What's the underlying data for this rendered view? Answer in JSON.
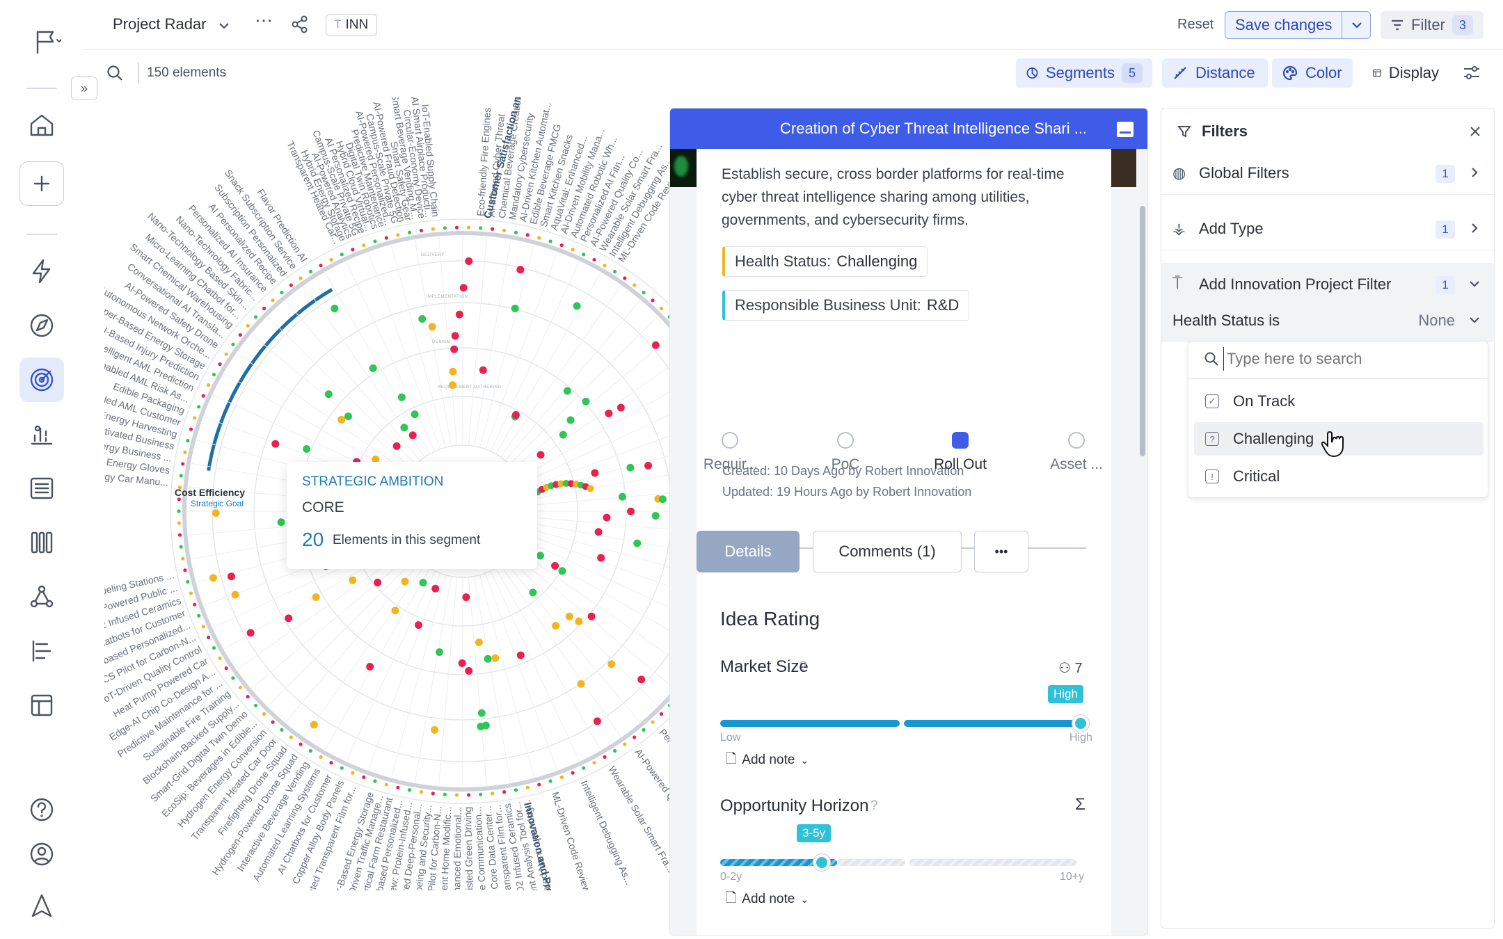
{
  "app": {
    "project_name": "Project Radar",
    "tag_label": "INN",
    "element_count": "150 elements"
  },
  "header": {
    "reset_label": "Reset",
    "save_label": "Save changes",
    "filter_label": "Filter",
    "filter_count": "3"
  },
  "toolbar": {
    "segments_label": "Segments",
    "segments_count": "5",
    "distance_label": "Distance",
    "color_label": "Color",
    "display_label": "Display"
  },
  "radar": {
    "tooltip_heading": "STRATEGIC AMBITION",
    "tooltip_segment": "CORE",
    "tooltip_count": "20",
    "tooltip_suffix": "Elements in this segment",
    "goal_label": "Cost Efficiency",
    "goal_sub": "Strategic Goal",
    "segment_top": "Customer Satisfaction and ...",
    "segment_bottom": "Innovation and Product De...",
    "ring_labels": [
      "DELIVERY",
      "IMPLEMENTATION",
      "DESIGN",
      "REQUIREMENT GATHERING"
    ],
    "left_labels": [
      "Hydrogen Energy Car Manu...",
      "Smart Energy Gloves",
      "Smart Energy Business ...",
      "Voice-Activated Business",
      "Hydrogen Energy Harvesting",
      "AI-Enabled AML Customer",
      "Edible Packaging",
      "AI-Enabled AML Risk As...",
      "Intelligent AML Prediction",
      "AI-Based Injury Prediction",
      "Copper-Based Energy Storage",
      "Autonomous Network Orche...",
      "AI-Powered Safety Drone",
      "Conversational AI Transla...",
      "Smart Chemical Warehousing",
      "Micro-Learning Chatbot for...",
      "Nano-Technology Based Skin...",
      "Nano-Technology Fabric...",
      "Personalized AI Insurance",
      "AI Personalized Recipe",
      "Subscription Personalized",
      "Snack Subscription Service",
      "Flavor Prediction AI",
      "Hydrogen Fueling Stations ...",
      "Hydrogen-Powered Public ...",
      "TiO2 Infused Ceramics",
      "AI Chatbots for Customer",
      "Cloud-based Personalized...",
      "BECCS Pilot for Carbon-N...",
      "IoT-Driven Quality Control",
      "Heat Pump Powered Car",
      "Edge-AI Chip Co-Design A...",
      "Predictive Maintenance for ...",
      "Sustainable Fire Training",
      "Blockchain-Backed Supply...",
      "Smart-Grid Digital Twin Demo",
      "EcoSip: Beverages in Edible...",
      "Hydrogen Energy Conversion",
      "Transparent Heated Car Door",
      "Firefighting Drone Squad",
      "Hydrogen-Powered Drone Squad",
      "Interactive Beverage Vending",
      "Automated Learning Systems",
      "AI Chatbots for Customer",
      "Copper Alloy Body Panels",
      "Heated Transparent Film for..."
    ],
    "top_labels": [
      "Transparent Heated Car...",
      "Hybrid Energy Storage",
      "AI-Powered Analytics",
      "Campus-Scale Private 5G",
      "AI Personalized Recipe",
      "Hybrid Cloud Virtual...",
      "Digital Twin Robotics",
      "Predictive Maintenance",
      "AI-Powered Personalized...",
      "Campus-Scale Private 5G",
      "AI-Powered Fraud Detection",
      "Smart Safety Gear",
      "Smart Beverage Vending M...",
      "Circular-Economy Device",
      "AI Smart Airplace Producti...",
      "IoT-Enabled Supply Chain"
    ],
    "right_labels": [
      "Eco-friendly Fire Engines",
      "AI-Infused Cyber Threat",
      "Chemical Beverage Creation",
      "Mandatory Cybersecurity",
      "AI-Driven Kitchen Automat...",
      "Edible Beverage FMCG",
      "Smart Kitchen Snacks",
      "AquaVital: Enhanced...",
      "AI-Driven Mobility Mana...",
      "Automated Robotic Wh...",
      "Personalized AI Fitn...",
      "AI-Powered Quality Co...",
      "Wearable Solar Smart Fra...",
      "Intelligent Debugging As...",
      "ML-Driven Code Review System"
    ],
    "bottom_labels": [
      "Copper-Based Energy Storage",
      "AI-Driven Traffic Manage...",
      "Vertical Farm Restaurant",
      "Cloud-based Personalized...",
      "Proteindrew: Protein-Infused...",
      "Federated Deep-Personal...",
      "Well-being and Security...",
      "BECCS Pilot for Carbon-N...",
      "Intelligent Home Modific...",
      "AI-Enhanced Emotional...",
      "AI-Assisted Green Driving",
      "Immersive Communication...",
      "Sustainable Core Data Center...",
      "AI-Heated Transparent Film for...",
      "TiO2 Infused Ceramics",
      "Sentiment Analysis Tool for...",
      "AI-Generated Nano-Learning..."
    ]
  },
  "detail": {
    "title": "Creation of Cyber Threat Intelligence Shari ...",
    "description_lines": [
      "Establish secure, cross border platforms for real-time",
      "cyber threat intelligence sharing among utilities,",
      "governments, and cybersecurity firms."
    ],
    "health_label": "Health Status:",
    "health_value": "Challenging",
    "bu_label": "Responsible Business Unit:",
    "bu_value": "R&D",
    "created": "Created: 10 Days Ago by Robert Innovation",
    "updated": "Updated: 19 Hours Ago by Robert Innovation",
    "steps": [
      "Requir...",
      "PoC",
      "Roll Out",
      "Asset ..."
    ],
    "active_step": 2,
    "tabs": {
      "details": "Details",
      "comments": "Comments (1)",
      "more": "•••"
    },
    "rating_title": "Idea Rating",
    "market_size": {
      "label": "Market Size",
      "voters": "7",
      "badge": "High",
      "low": "Low",
      "high": "High",
      "value": 1.0,
      "note": "Add note"
    },
    "horizon": {
      "label": "Opportunity Horizon",
      "badge": "3-5y",
      "low": "0-2y",
      "high": "10+y",
      "value": 0.33,
      "note": "Add note"
    }
  },
  "filters": {
    "title": "Filters",
    "global": {
      "label": "Global Filters",
      "count": "1"
    },
    "type": {
      "label": "Add Type",
      "count": "1"
    },
    "innovation": {
      "label": "Add Innovation Project Filter",
      "count": "1"
    },
    "health_label": "Health Status is",
    "health_value": "None",
    "search_placeholder": "Type here to search",
    "options": [
      "On Track",
      "Challenging",
      "Critical"
    ]
  },
  "colors": {
    "accent": "#3f5ce8",
    "green": "#2fc655",
    "red": "#e8214e",
    "yellow": "#f2b521",
    "slider": "#1696d2"
  }
}
